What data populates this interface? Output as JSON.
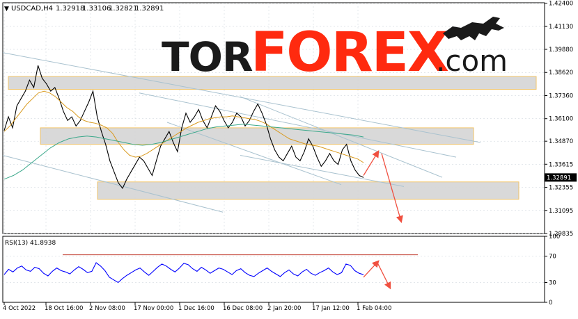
{
  "chart_header": {
    "symbol_timeframe": "USDCAD,H4",
    "open": "1.32918",
    "high": "1.33106",
    "low": "1.32821",
    "close": "1.32891"
  },
  "logo": {
    "part1": "TOR",
    "part2": "FOREX",
    "part3": ".com",
    "color_dark": "#1a1a1a",
    "color_red": "#ff2a0f"
  },
  "colors": {
    "price_line": "#000000",
    "ma_fast": "#d99a1e",
    "ma_slow": "#3aa88a",
    "trend_lines": "#a9c2cf",
    "zone_fill": "#d8d8d8",
    "zone_border": "#f0c060",
    "rsi_line": "#0000ff",
    "rsi_ref_line": "#c0392b",
    "forecast_arrow": "#f05040",
    "grid": "#c8d0d8",
    "current_price_tag_bg": "#000000"
  },
  "chart_data": {
    "type": "line",
    "price_panel": {
      "ylim": [
        1.29835,
        1.4242
      ],
      "yticks": [
        "1.42400",
        "1.41130",
        "1.39880",
        "1.38620",
        "1.37360",
        "1.36100",
        "1.34870",
        "1.33615",
        "1.32355",
        "1.31095",
        "1.29835"
      ],
      "current_price": "1.32891",
      "series": [
        {
          "values": [
            1.3545,
            1.362,
            1.356,
            1.368,
            1.372,
            1.376,
            1.382,
            1.378,
            1.39,
            1.383,
            1.38,
            1.376,
            1.378,
            1.372,
            1.365,
            1.36,
            1.362,
            1.357,
            1.36,
            1.365,
            1.37,
            1.376,
            1.362,
            1.354,
            1.347,
            1.338,
            1.332,
            1.326,
            1.323,
            1.328,
            1.332,
            1.336,
            1.34,
            1.338,
            1.334,
            1.33,
            1.338,
            1.346,
            1.35,
            1.354,
            1.348,
            1.343,
            1.356,
            1.364,
            1.359,
            1.362,
            1.366,
            1.36,
            1.356,
            1.362,
            1.368,
            1.365,
            1.36,
            1.356,
            1.359,
            1.364,
            1.362,
            1.357,
            1.36,
            1.365,
            1.369,
            1.364,
            1.358,
            1.35,
            1.344,
            1.34,
            1.338,
            1.342,
            1.346,
            1.34,
            1.338,
            1.343,
            1.35,
            1.346,
            1.34,
            1.335,
            1.338,
            1.342,
            1.338,
            1.336,
            1.344,
            1.347,
            1.338,
            1.333,
            1.33,
            1.3289
          ]
        },
        {
          "values": [
            1.354,
            1.357,
            1.361,
            1.365,
            1.369,
            1.372,
            1.375,
            1.376,
            1.375,
            1.373,
            1.37,
            1.367,
            1.365,
            1.362,
            1.36,
            1.359,
            1.3585,
            1.3575,
            1.356,
            1.353,
            1.348,
            1.344,
            1.341,
            1.34,
            1.3405,
            1.342,
            1.344,
            1.346,
            1.348,
            1.35,
            1.352,
            1.354,
            1.356,
            1.3575,
            1.359,
            1.36,
            1.361,
            1.3615,
            1.362,
            1.362,
            1.3625,
            1.362,
            1.3615,
            1.361,
            1.3605,
            1.3595,
            1.358,
            1.356,
            1.354,
            1.352,
            1.35,
            1.349,
            1.348,
            1.347,
            1.3465,
            1.346,
            1.345,
            1.344,
            1.343,
            1.342,
            1.341,
            1.34,
            1.339,
            1.337
          ]
        },
        {
          "values": [
            1.328,
            1.33,
            1.333,
            1.337,
            1.341,
            1.345,
            1.348,
            1.35,
            1.351,
            1.3515,
            1.351,
            1.35,
            1.349,
            1.348,
            1.347,
            1.3465,
            1.347,
            1.348,
            1.3495,
            1.351,
            1.3525,
            1.354,
            1.3555,
            1.3565,
            1.357,
            1.3575,
            1.358,
            1.3575,
            1.357,
            1.3565,
            1.356,
            1.3555,
            1.355,
            1.3545,
            1.354,
            1.3535,
            1.353,
            1.3525,
            1.352,
            1.351
          ]
        }
      ]
    },
    "rsi_panel": {
      "title": "RSI(13) 41.8938",
      "ylim": [
        0,
        100
      ],
      "yticks": [
        "100",
        "70",
        "30",
        "0"
      ],
      "levels": [
        70,
        30
      ],
      "values": [
        42,
        50,
        46,
        52,
        55,
        49,
        47,
        53,
        51,
        44,
        40,
        47,
        52,
        48,
        46,
        43,
        49,
        54,
        50,
        45,
        47,
        60,
        55,
        48,
        38,
        34,
        30,
        36,
        41,
        45,
        49,
        52,
        46,
        41,
        47,
        53,
        58,
        55,
        50,
        46,
        52,
        59,
        57,
        51,
        47,
        53,
        49,
        44,
        48,
        52,
        50,
        46,
        42,
        48,
        51,
        45,
        41,
        39,
        44,
        48,
        52,
        47,
        43,
        39,
        45,
        49,
        43,
        40,
        46,
        50,
        44,
        41,
        45,
        48,
        52,
        46,
        42,
        45,
        58,
        56,
        48,
        44,
        41.89
      ]
    },
    "x_axis": {
      "tick_labels": [
        "4 Oct 2022",
        "18 Oct 16:00",
        "2 Nov 08:00",
        "17 Nov 00:00",
        "1 Dec 16:00",
        "16 Dec 08:00",
        "2 Jan 20:00",
        "17 Jan 12:00",
        "1 Feb 04:00"
      ]
    },
    "annotations": {
      "support_resistance_zones": 3,
      "trend_lines": 6,
      "forecast_arrows": "up then down"
    }
  }
}
